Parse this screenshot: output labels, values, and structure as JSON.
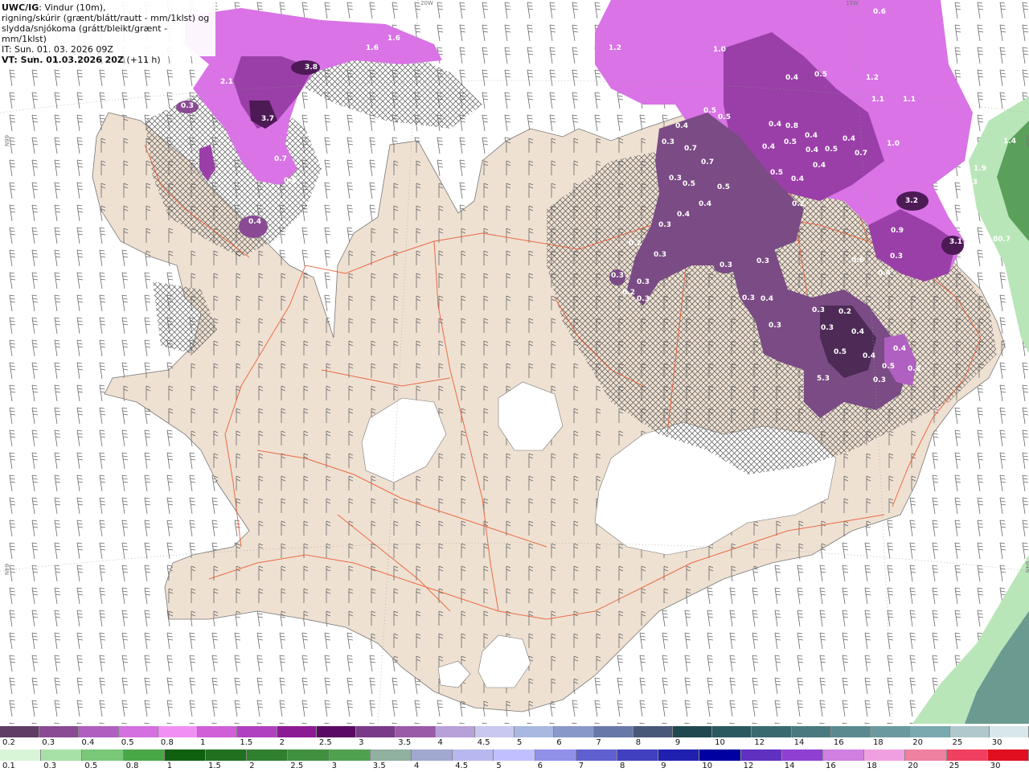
{
  "header": {
    "product": "UWC/IG",
    "line1_rest": ": Vindur (10m),",
    "line2": "rigning/skúrir (grænt/blátt/rautt - mm/1klst) og",
    "line3": "slydda/snjókoma (grátt/bleikt/grænt - mm/1klst)",
    "it_line": "IT: Sun. 01. 03. 2026 09Z",
    "vt_bold": "VT: Sun. 01.03.2026 20Z",
    "vt_rest": " (+11 h)"
  },
  "grid_labels": [
    "20W",
    "15W",
    "66N",
    "64N",
    "66N",
    "64N"
  ],
  "precip_labels": [
    "3.8",
    "2.1",
    "3.7",
    "1.6",
    "1.6",
    "0.3",
    "0.7",
    "0.4",
    "0.4",
    "0.6",
    "1.2",
    "1.0",
    "0.4",
    "0.5",
    "1.2",
    "1.1",
    "1.1",
    "0.5",
    "0.4",
    "0.4",
    "0.7",
    "0.3",
    "0.7",
    "0.8",
    "0.4",
    "0.5",
    "0.4",
    "0.4",
    "0.5",
    "0.4",
    "0.5",
    "0.7",
    "1.0",
    "0.5",
    "0.4",
    "0.5",
    "0.4",
    "0.3",
    "0.4",
    "0.5",
    "0.4",
    "0.2",
    "1.0",
    "3.2",
    "1.4",
    "1.9",
    "0.3",
    "0.9",
    "3.1",
    "80.7",
    "0.3",
    "0.2",
    "0.3",
    "0.6",
    "0.3",
    "0.4",
    "0.3",
    "0.2",
    "0.3",
    "0.3",
    "0.3",
    "0.3",
    "0.3",
    "0.4",
    "0.3",
    "0.2",
    "0.3",
    "0.4",
    "0.3",
    "0.5",
    "0.4",
    "0.4",
    "0.5",
    "0.3",
    "0.3",
    "5.3"
  ],
  "legend_snow": {
    "values": [
      "0.2",
      "0.3",
      "0.4",
      "0.5",
      "0.8",
      "1",
      "1.5",
      "2",
      "2.5",
      "3",
      "3.5",
      "4",
      "4.5",
      "5",
      "6",
      "7",
      "8",
      "9",
      "10",
      "12",
      "14",
      "16",
      "18",
      "20",
      "25",
      "30"
    ],
    "colors": [
      "#5f3d64",
      "#8a4a94",
      "#b05ec0",
      "#d470e0",
      "#f090f5",
      "#d05fd8",
      "#b040c0",
      "#8c1a95",
      "#5a0a62",
      "#7a3a8a",
      "#9a5aa8",
      "#b8a0d8",
      "#c8c8f0",
      "#a8b8e0",
      "#8898c8",
      "#6878a8",
      "#485878",
      "#204850",
      "#2a5a60",
      "#3a6a70",
      "#4a7a80",
      "#5a8a90",
      "#6a9aa0",
      "#7aaab0",
      "#b0c8cc",
      "#d8e8ea"
    ]
  },
  "legend_rain": {
    "values": [
      "0.1",
      "0.3",
      "0.5",
      "0.8",
      "1",
      "1.5",
      "2",
      "2.5",
      "3",
      "3.5",
      "4",
      "4.5",
      "5",
      "6",
      "7",
      "8",
      "9",
      "10",
      "12",
      "14",
      "16",
      "18",
      "20",
      "25",
      "30"
    ],
    "colors": [
      "#d8f5d8",
      "#a8e0a8",
      "#78c878",
      "#48a848",
      "#106010",
      "#207020",
      "#308030",
      "#409040",
      "#50a050",
      "#90b0a0",
      "#a0a8d0",
      "#b8b8f0",
      "#c0c0ff",
      "#9090e8",
      "#6060d0",
      "#4040c0",
      "#2020b0",
      "#0000a0",
      "#6030c0",
      "#9040d0",
      "#d080e0",
      "#f0a0e0",
      "#f080a0",
      "#f04060",
      "#e01020"
    ]
  },
  "colors": {
    "land": "#efe1d2",
    "ice": "#ffffff",
    "sea": "#ffffff",
    "roads": "#e8572e",
    "snow_light": "#7a4b84",
    "snow_dark": "#4d2b56",
    "snow_magenta": "#d973e6",
    "rain_green": "#b8e6b8"
  }
}
